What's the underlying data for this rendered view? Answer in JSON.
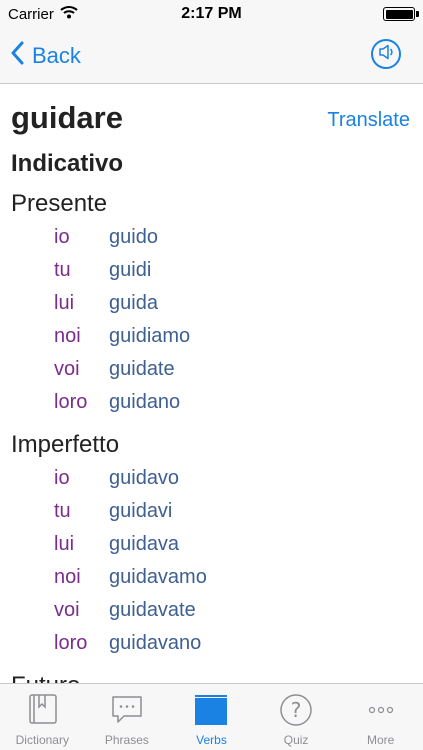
{
  "status_bar": {
    "carrier": "Carrier",
    "time": "2:17 PM"
  },
  "nav": {
    "back_label": "Back"
  },
  "verb": {
    "title": "guidare",
    "translate_label": "Translate",
    "mood": "Indicativo"
  },
  "tenses": [
    {
      "name": "Presente",
      "rows": [
        {
          "pronoun": "io",
          "form": "guido"
        },
        {
          "pronoun": "tu",
          "form": "guidi"
        },
        {
          "pronoun": "lui",
          "form": "guida"
        },
        {
          "pronoun": "noi",
          "form": "guidiamo"
        },
        {
          "pronoun": "voi",
          "form": "guidate"
        },
        {
          "pronoun": "loro",
          "form": "guidano"
        }
      ]
    },
    {
      "name": "Imperfetto",
      "rows": [
        {
          "pronoun": "io",
          "form": "guidavo"
        },
        {
          "pronoun": "tu",
          "form": "guidavi"
        },
        {
          "pronoun": "lui",
          "form": "guidava"
        },
        {
          "pronoun": "noi",
          "form": "guidavamo"
        },
        {
          "pronoun": "voi",
          "form": "guidavate"
        },
        {
          "pronoun": "loro",
          "form": "guidavano"
        }
      ]
    },
    {
      "name": "Futuro",
      "rows": []
    }
  ],
  "tab_bar": {
    "tabs": [
      {
        "label": "Dictionary",
        "icon": "book-icon",
        "active": false
      },
      {
        "label": "Phrases",
        "icon": "speech-bubble-icon",
        "active": false
      },
      {
        "label": "Verbs",
        "icon": "verbs-stack-icon",
        "active": true
      },
      {
        "label": "Quiz",
        "icon": "question-icon",
        "active": false
      },
      {
        "label": "More",
        "icon": "more-dots-icon",
        "active": false
      }
    ]
  },
  "colors": {
    "accent": "#1a82e3",
    "pronoun": "#7a2d8c",
    "conjugation": "#3e5f92"
  }
}
